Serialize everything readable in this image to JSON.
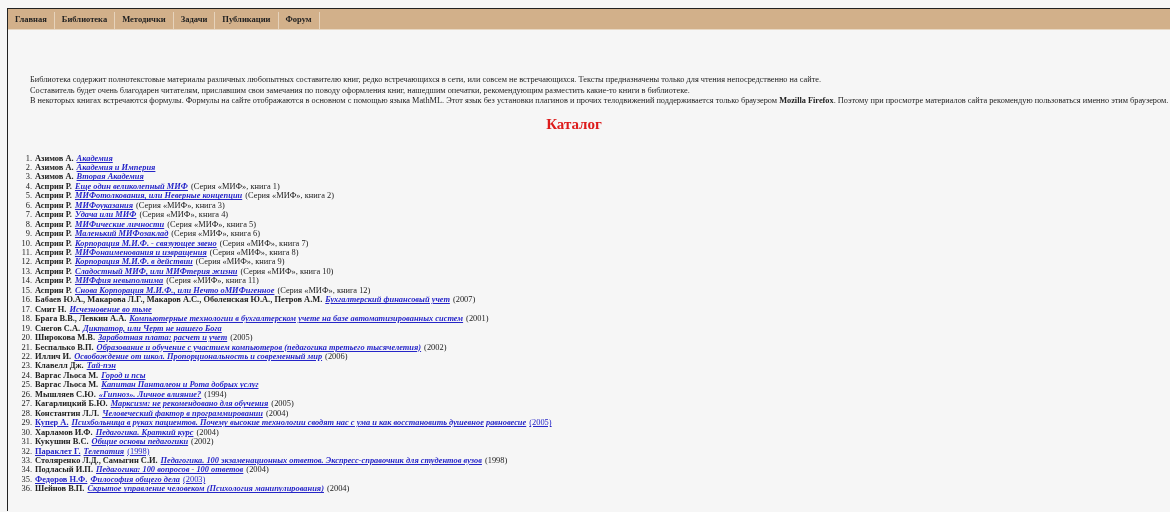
{
  "nav": [
    {
      "label": "Главная"
    },
    {
      "label": "Библиотека"
    },
    {
      "label": "Методички"
    },
    {
      "label": "Задачи"
    },
    {
      "label": "Публикации"
    },
    {
      "label": "Форум"
    }
  ],
  "intro": [
    "Библиотека содержит полнотекстовые материалы различных любопытных составителю книг, редко встречающихся в сети, или совсем не встречающихся. Тексты предназначены только для чтения непосредственно на сайте.",
    "Составитель будет очень благодарен читателям, приславшим свои замечания по поводу оформления книг, нашедшим опечатки, рекомендующим разместить какие-то книги в библиотеке.",
    "В некоторых книгах встречаются формулы. Формулы на сайте отображаются в основном с помощью языка MathML. Этот язык без установки плагинов и прочих телодвижений поддерживается только браузером **Mozilla Firefox**. Поэтому при просмотре материалов сайта рекомендую пользоваться именно этим браузером."
  ],
  "heading": "Каталог",
  "catalog": [
    {
      "number": "1.",
      "author": "Азимов А.",
      "title": "Академия",
      "kind": "plain"
    },
    {
      "number": "2.",
      "author": "Азимов А.",
      "title": "Академия и Империя",
      "kind": "plain"
    },
    {
      "number": "3.",
      "author": "Азимов А.",
      "title": "Вторая Академия",
      "kind": "plain"
    },
    {
      "number": "4.",
      "author": "Асприн Р.",
      "title": "Еще один великолепный МИФ",
      "note": "(Серия «МИФ», книга 1)",
      "kind": "plain"
    },
    {
      "number": "5.",
      "author": "Асприн Р.",
      "title": "МИФотолкования, или Неверные концепции",
      "note": "(Серия «МИФ», книга 2)",
      "kind": "plain"
    },
    {
      "number": "6.",
      "author": "Асприн Р.",
      "title": "МИФоуказания",
      "note": "(Серия «МИФ», книга 3)",
      "kind": "plain"
    },
    {
      "number": "7.",
      "author": "Асприн Р.",
      "title": "Удача или МИФ",
      "note": "(Серия «МИФ», книга 4)",
      "kind": "plain"
    },
    {
      "number": "8.",
      "author": "Асприн Р.",
      "title": "МИФические личности",
      "note": "(Серия «МИФ», книга 5)",
      "kind": "plain"
    },
    {
      "number": "9.",
      "author": "Асприн Р.",
      "title": "Маленький МИФозаклад",
      "note": "(Серия «МИФ», книга 6)",
      "kind": "plain"
    },
    {
      "number": "10.",
      "author": "Асприн Р.",
      "title": "Корпорация М.И.Ф. - связующее звено",
      "note": "(Серия «МИФ», книга 7)",
      "kind": "plain"
    },
    {
      "number": "11.",
      "author": "Асприн Р.",
      "title": "МИФонаименования и извращения",
      "note": "(Серия «МИФ», книга 8)",
      "kind": "plain"
    },
    {
      "number": "12.",
      "author": "Асприн Р.",
      "title": "Корпорация М.И.Ф. в действии",
      "note": "(Серия «МИФ», книга 9)",
      "kind": "plain"
    },
    {
      "number": "13.",
      "author": "Асприн Р.",
      "title": "Сладостный МИФ, или МИФтерия жизни",
      "note": "(Серия «МИФ», книга 10)",
      "kind": "plain"
    },
    {
      "number": "14.",
      "author": "Асприн Р.",
      "title": "МИФфия невыполнима",
      "note": "(Серия «МИФ», книга 11)",
      "kind": "plain"
    },
    {
      "number": "15.",
      "author": "Асприн Р.",
      "title": "Снова Корпорация М.И.Ф., или Нечто оМИФигенное",
      "note": "(Серия «МИФ», книга 12)",
      "kind": "plain"
    },
    {
      "number": "16.",
      "author": "Бабаев Ю.А., Макарова Л.Г., Макаров А.С., Оболенская Ю.А., Петров А.М.",
      "title": "Бухгалтерский финансовый учет",
      "note": "(2007)",
      "kind": "plain"
    },
    {
      "number": "17.",
      "author": "Смит Н.",
      "title": "Исчезновение во тьме",
      "kind": "plain"
    },
    {
      "number": "18.",
      "author": "Брага В.В., Левкин А.А.",
      "title": "Компьютерные технологии в бухгалтерском учете на базе автоматизированных систем",
      "note": "(2001)",
      "kind": "plain"
    },
    {
      "number": "19.",
      "author": "Снегов С.А.",
      "title": "Диктатор, или Черт не нашего Бога",
      "kind": "plain"
    },
    {
      "number": "20.",
      "author": "Широкова М.В.",
      "title": "Заработная плата: расчет и учет",
      "note": "(2005)",
      "kind": "plain"
    },
    {
      "number": "21.",
      "author": "Беспалько В.П.",
      "title": "Образование и обучение с участием компьютеров (педагогика третьего тысячелетия)",
      "note": "(2002)",
      "kind": "plain"
    },
    {
      "number": "22.",
      "author": "Иллич И.",
      "title": "Освобождение от школ. Пропорциональность и современный мир",
      "note": "(2006)",
      "kind": "plain"
    },
    {
      "number": "23.",
      "author": "Клавелл Дж.",
      "title": "Тай-пэн",
      "kind": "plain"
    },
    {
      "number": "24.",
      "author": "Варгас Льоса М.",
      "title": "Город и псы",
      "kind": "plain"
    },
    {
      "number": "25.",
      "author": "Варгас Льоса М.",
      "title": "Капитан Панталеон и Рота добрых услуг",
      "kind": "plain"
    },
    {
      "number": "26.",
      "author": "Мышляев С.Ю.",
      "title": "«Гипноз». Личное влияние?",
      "note": "(1994)",
      "kind": "plain"
    },
    {
      "number": "27.",
      "author": "Кагарлицкий Б.Ю.",
      "title": "Марксизм: не рекомендовано для обучения",
      "note": "(2005)",
      "kind": "plain"
    },
    {
      "number": "28.",
      "author": "Константин Л.Л.",
      "title": "Человеческий фактор в программировании",
      "note": "(2004)",
      "kind": "plain"
    },
    {
      "number": "29.",
      "author": "Купер А.",
      "title": "Психбольница в руках пациентов. Почему высокие технологии сводят нас с ума и как восстановить душевное равновесие",
      "note": "(2005)",
      "kind": "linked"
    },
    {
      "number": "30.",
      "author": "Харламов И.Ф.",
      "title": "Педагогика. Краткий курс",
      "note": "(2004)",
      "kind": "plain"
    },
    {
      "number": "31.",
      "author": "Кукушин В.С.",
      "title": "Общие основы педагогики",
      "note": "(2002)",
      "kind": "plain"
    },
    {
      "number": "32.",
      "author": "Параклет Г.",
      "title": "Телепатия",
      "note": "(1998)",
      "kind": "linked"
    },
    {
      "number": "33.",
      "author": "Столяренко Л.Д., Самыгин С.И.",
      "title": "Педагогика. 100 экзаменационных ответов. Экспресс-справочник для студентов вузов",
      "note": "(1998)",
      "kind": "plain"
    },
    {
      "number": "34.",
      "author": "Подласый И.П.",
      "title": "Педагогика: 100 вопросов - 100 ответов",
      "note": "(2004)",
      "kind": "plain"
    },
    {
      "number": "35.",
      "author": "Федоров Н.Ф.",
      "title": "Философия общего дела",
      "note": "(2003)",
      "kind": "linked"
    },
    {
      "number": "36.",
      "author": "Шейнов В.П.",
      "title": "Скрытое управление человеком (Психология манипулирования)",
      "note": "(2004)",
      "kind": "plain"
    }
  ]
}
